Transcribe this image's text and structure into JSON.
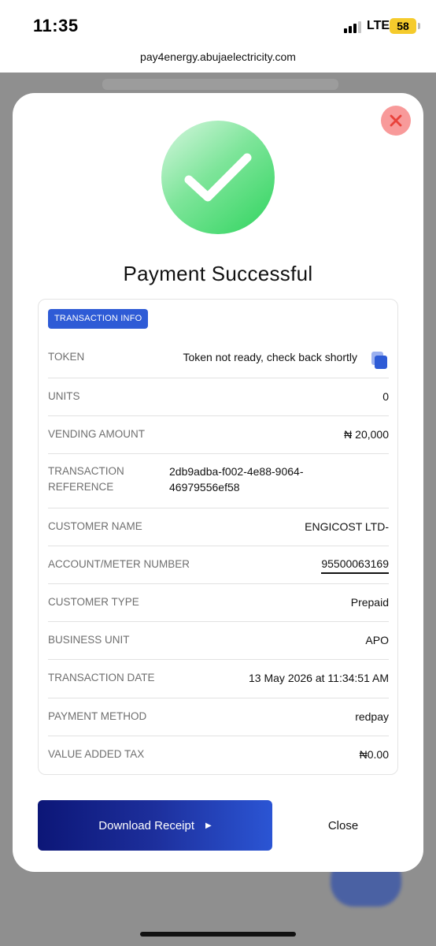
{
  "status_bar": {
    "time": "11:35",
    "network": "LTE",
    "battery": "58"
  },
  "browser": {
    "url": "pay4energy.abujaelectricity.com"
  },
  "modal": {
    "title": "Payment Successful",
    "tag": "TRANSACTION INFO",
    "rows": [
      {
        "label": "TOKEN",
        "value": "Token not ready, check back shortly"
      },
      {
        "label": "UNITS",
        "value": "0"
      },
      {
        "label": "VENDING AMOUNT",
        "value": "₦ 20,000"
      },
      {
        "label_line1": "TRANSACTION",
        "label_line2": "REFERENCE",
        "value_line1": "2db9adba-f002-4e88-9064-",
        "value_line2": "46979556ef58"
      },
      {
        "label": "CUSTOMER NAME",
        "value": "ENGICOST LTD-"
      },
      {
        "label": "ACCOUNT/METER NUMBER",
        "value": "95500063169"
      },
      {
        "label": "CUSTOMER TYPE",
        "value": "Prepaid"
      },
      {
        "label": "BUSINESS UNIT",
        "value": "APO"
      },
      {
        "label": "TRANSACTION DATE",
        "value": "13 May 2026 at 11:34:51 AM"
      },
      {
        "label": "PAYMENT METHOD",
        "value": "redpay"
      },
      {
        "label": "VALUE ADDED TAX",
        "value": "₦0.00"
      }
    ],
    "download_label": "Download Receipt",
    "close_label": "Close"
  },
  "colors": {
    "accent": "#2e5bd6",
    "success": "#2fd45e",
    "danger": "#e8423b",
    "button_dark": "#0c1677"
  },
  "icons": [
    "close-icon",
    "checkmark-icon",
    "copy-icon",
    "caret-right-icon"
  ]
}
